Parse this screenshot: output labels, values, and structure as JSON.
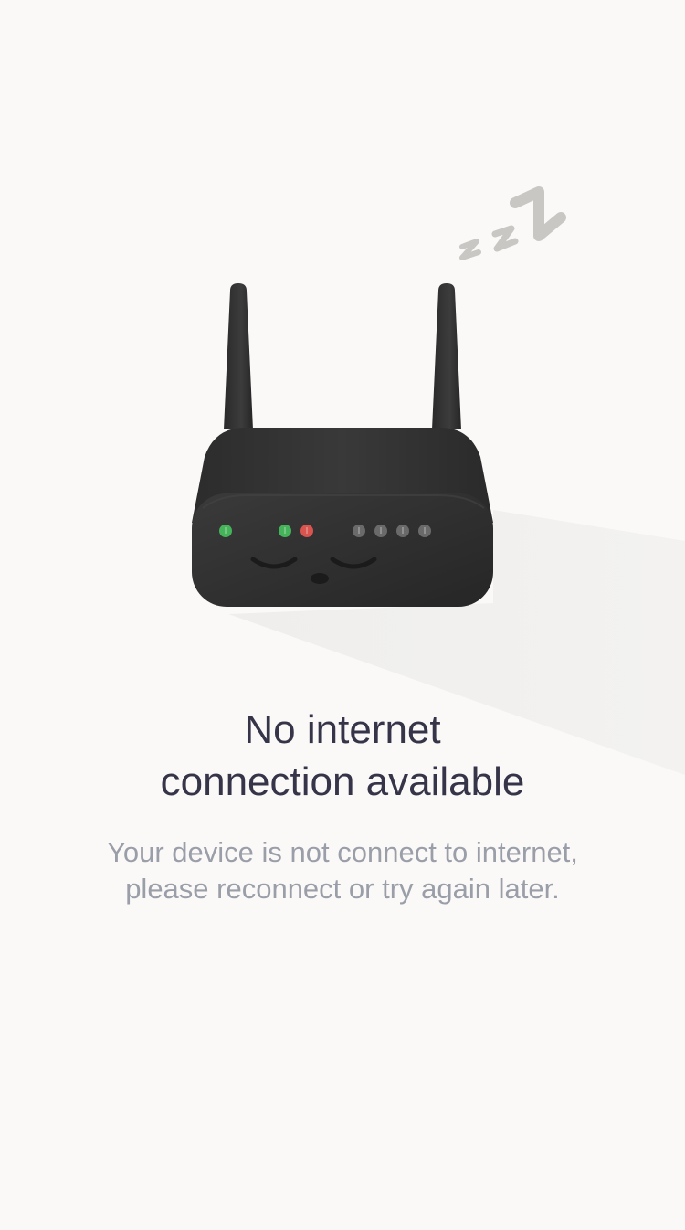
{
  "illustration": {
    "name": "sleeping-router",
    "status_lights": [
      "green",
      "green",
      "red",
      "gray",
      "gray",
      "gray",
      "gray"
    ],
    "snore_text": "zzZ"
  },
  "message": {
    "title_line1": "No internet",
    "title_line2": "connection available",
    "body_line1": "Your device is not connect to internet,",
    "body_line2": "please reconnect or try again later."
  },
  "colors": {
    "background": "#faf9f7",
    "title": "#363448",
    "body": "#9a9ea8",
    "router": "#2f2f2f",
    "light_green": "#45b35a",
    "light_red": "#d9534f",
    "light_gray": "#6a6a6a"
  }
}
